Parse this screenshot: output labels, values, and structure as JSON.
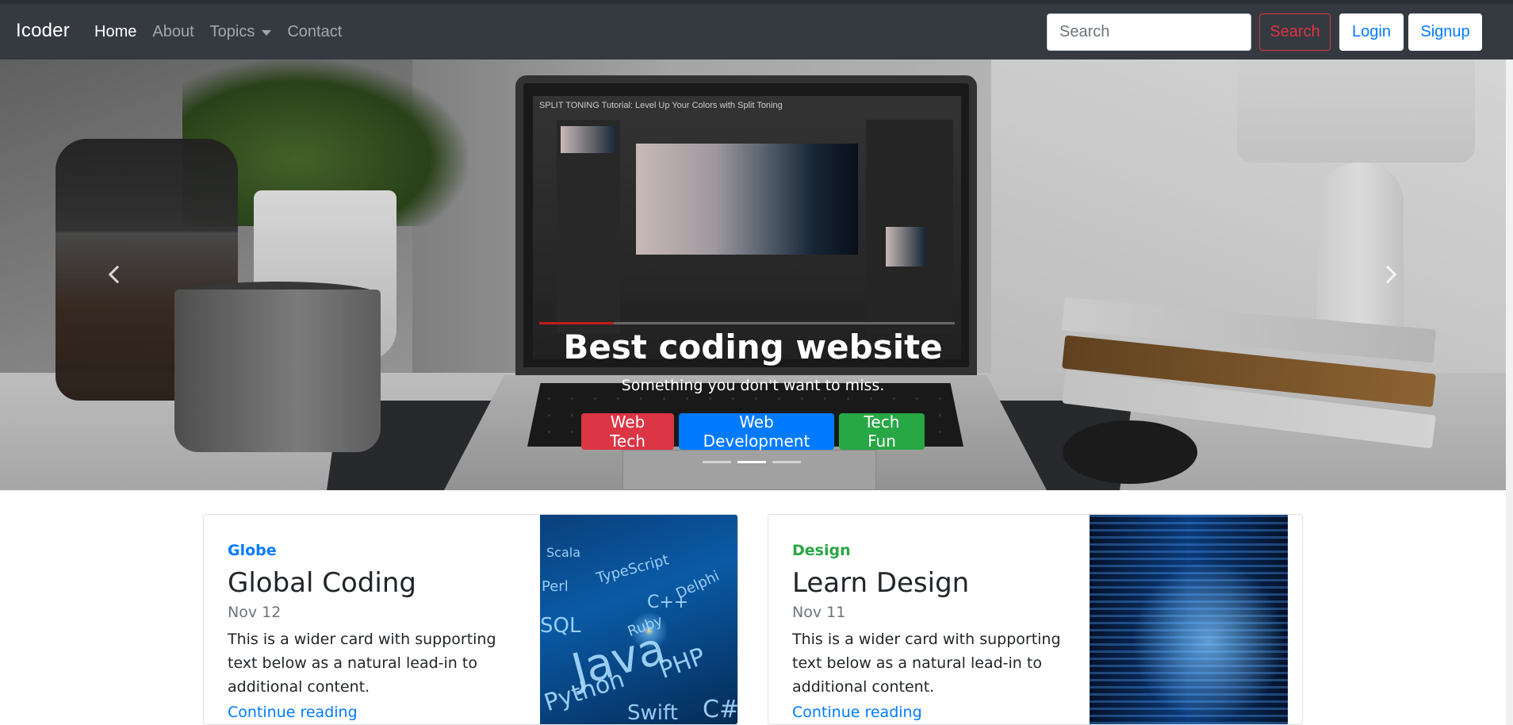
{
  "navbar": {
    "brand": "Icoder",
    "links": [
      {
        "label": "Home",
        "active": true
      },
      {
        "label": "About",
        "active": false
      },
      {
        "label": "Topics",
        "active": false,
        "dropdown": true
      },
      {
        "label": "Contact",
        "active": false
      }
    ],
    "search_placeholder": "Search",
    "search_button": "Search",
    "login_button": "Login",
    "signup_button": "Signup"
  },
  "carousel": {
    "screen_title": "SPLIT TONING Tutorial: Level Up Your Colors with Split Toning",
    "caption_title": "Best coding website",
    "caption_subtitle": "Something you don't want to miss.",
    "buttons": [
      {
        "label": "Web Tech",
        "color": "#dc3545"
      },
      {
        "label": "Web Development",
        "color": "#007bff"
      },
      {
        "label": "Tech Fun",
        "color": "#28a745"
      }
    ],
    "slide_count": 3,
    "active_slide": 2
  },
  "cards": [
    {
      "category": "Globe",
      "category_color": "#007bff",
      "title": "Global Coding",
      "date": "Nov 12",
      "text": "This is a wider card with supporting text below as a natural lead-in to additional content.",
      "link": "Continue reading",
      "image_words": [
        "Scala",
        "TypeScript",
        "Perl",
        "C++",
        "Ruby",
        "Java",
        "PHP",
        "Python",
        "Swift",
        "C#",
        "SQL",
        "Delphi"
      ]
    },
    {
      "category": "Design",
      "category_color": "#28a745",
      "title": "Learn Design",
      "date": "Nov 11",
      "text": "This is a wider card with supporting text below as a natural lead-in to additional content.",
      "link": "Continue reading"
    }
  ],
  "colors": {
    "navbar_bg": "#343a40",
    "primary": "#007bff",
    "danger": "#dc3545",
    "success": "#28a745"
  }
}
